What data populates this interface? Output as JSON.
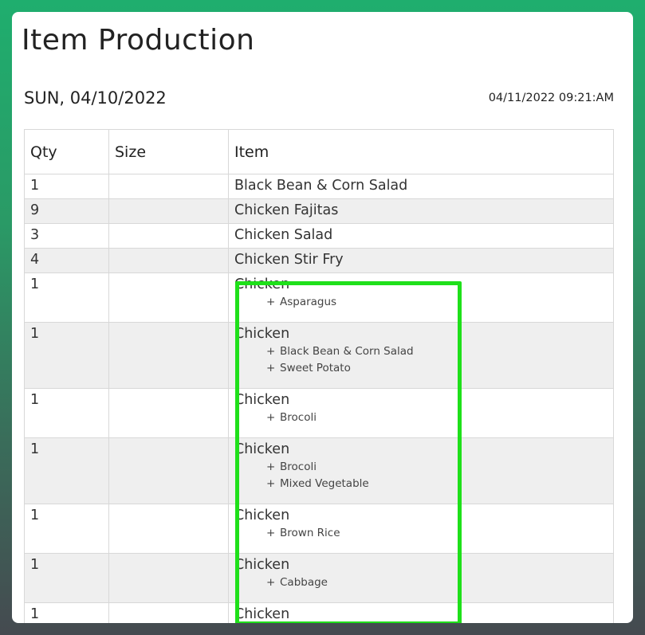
{
  "page": {
    "title": "Item Production",
    "date": "SUN, 04/10/2022",
    "timestamp": "04/11/2022 09:21:AM"
  },
  "table": {
    "headers": [
      "Qty",
      "Size",
      "Item"
    ],
    "rows": [
      {
        "qty": "1",
        "size": "",
        "item": "Black Bean & Corn Salad",
        "mods": []
      },
      {
        "qty": "9",
        "size": "",
        "item": "Chicken Fajitas",
        "mods": []
      },
      {
        "qty": "3",
        "size": "",
        "item": "Chicken Salad",
        "mods": []
      },
      {
        "qty": "4",
        "size": "",
        "item": "Chicken Stir Fry",
        "mods": []
      },
      {
        "qty": "1",
        "size": "",
        "item": "Chicken",
        "mods": [
          "Asparagus"
        ]
      },
      {
        "qty": "1",
        "size": "",
        "item": "Chicken",
        "mods": [
          "Black Bean & Corn Salad",
          "Sweet Potato"
        ]
      },
      {
        "qty": "1",
        "size": "",
        "item": "Chicken",
        "mods": [
          "Brocoli"
        ]
      },
      {
        "qty": "1",
        "size": "",
        "item": "Chicken",
        "mods": [
          "Brocoli",
          "Mixed Vegetable"
        ]
      },
      {
        "qty": "1",
        "size": "",
        "item": "Chicken",
        "mods": [
          "Brown Rice"
        ]
      },
      {
        "qty": "1",
        "size": "",
        "item": "Chicken",
        "mods": [
          "Cabbage"
        ]
      },
      {
        "qty": "1",
        "size": "",
        "item": "Chicken",
        "mods": []
      }
    ],
    "mod_prefix": "+"
  },
  "colors": {
    "highlight": "#1fe01a",
    "alt_row": "#efefef"
  }
}
